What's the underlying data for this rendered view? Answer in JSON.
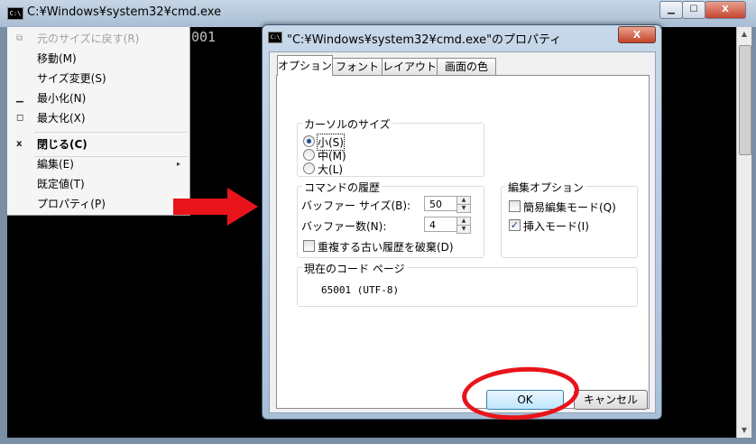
{
  "console": {
    "title": "C:¥Windows¥system32¥cmd.exe",
    "icon_text": "C:\\",
    "visible_text": "001",
    "buttons": {
      "minimize": "▁",
      "maximize": "☐",
      "close": "X"
    }
  },
  "system_menu": {
    "items": [
      {
        "label": "元のサイズに戻す(R)",
        "icon": "restore-icon",
        "glyph": "⧉"
      },
      {
        "label": "移動(M)"
      },
      {
        "label": "サイズ変更(S)"
      },
      {
        "label": "最小化(N)",
        "glyph": "▁"
      },
      {
        "label": "最大化(X)",
        "glyph": "◻"
      },
      {
        "label": "閉じる(C)",
        "glyph": "x"
      },
      {
        "label": "編集(E)",
        "submenu": "▸"
      },
      {
        "label": "既定値(T)"
      },
      {
        "label": "プロパティ(P)"
      }
    ]
  },
  "dialog": {
    "title": "\"C:¥Windows¥system32¥cmd.exe\"のプロパティ",
    "close_glyph": "X",
    "tabs": [
      "オプション",
      "フォント",
      "レイアウト",
      "画面の色"
    ],
    "cursor_size": {
      "title": "カーソルのサイズ",
      "options": [
        "小(S)",
        "中(M)",
        "大(L)"
      ],
      "selected": "小(S)"
    },
    "history": {
      "title": "コマンドの履歴",
      "buffer_size_label": "バッファー サイズ(B):",
      "buffer_size_value": "50",
      "buffer_count_label": "バッファー数(N):",
      "buffer_count_value": "4",
      "discard_label": "重複する古い履歴を破棄(D)",
      "discard_checked": false
    },
    "edit_options": {
      "title": "編集オプション",
      "quick_edit_label": "簡易編集モード(Q)",
      "quick_edit_checked": false,
      "insert_mode_label": "挿入モード(I)",
      "insert_mode_checked": true
    },
    "codepage": {
      "title": "現在のコード ページ",
      "value": "65001 (UTF-8)"
    },
    "ok_label": "OK",
    "cancel_label": "キャンセル"
  },
  "annotation_color": "#e8141b"
}
